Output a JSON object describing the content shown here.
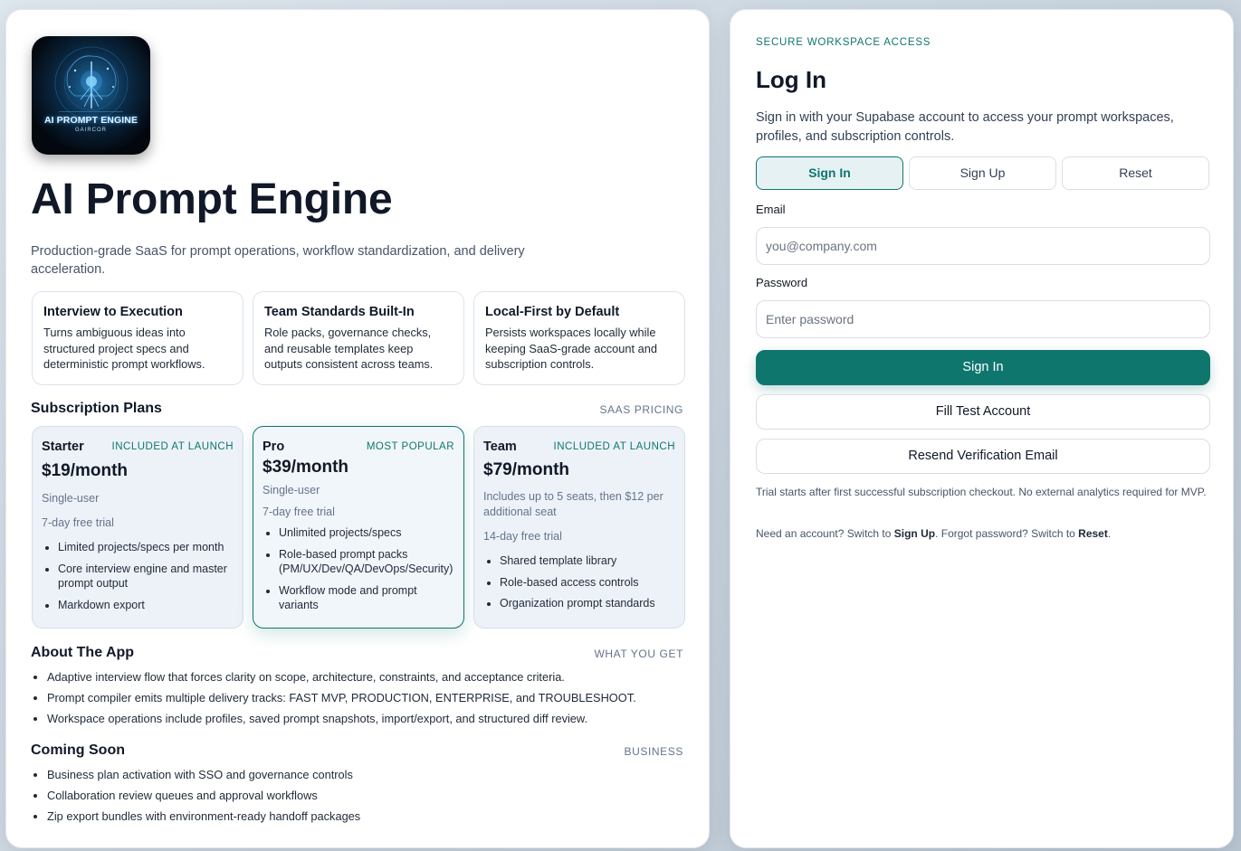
{
  "brand": {
    "logo_text": "AI PROMPT ENGINE",
    "logo_subtext": "GAIRCOR",
    "title": "AI Prompt Engine",
    "description": "Production-grade SaaS for prompt operations, workflow standardization, and delivery acceleration."
  },
  "features": [
    {
      "title": "Interview to Execution",
      "text": "Turns ambiguous ideas into structured project specs and deterministic prompt workflows."
    },
    {
      "title": "Team Standards Built-In",
      "text": "Role packs, governance checks, and reusable templates keep outputs consistent across teams."
    },
    {
      "title": "Local-First by Default",
      "text": "Persists workspaces locally while keeping SaaS-grade account and subscription controls."
    }
  ],
  "plans_section": {
    "title": "Subscription Plans",
    "tag": "SAAS PRICING"
  },
  "plans": [
    {
      "name": "Starter",
      "badge": "INCLUDED AT LAUNCH",
      "price": "$19/month",
      "meta1": "Single-user",
      "meta2": "7-day free trial",
      "features": [
        "Limited projects/specs per month",
        "Core interview engine and master prompt output",
        "Markdown export"
      ]
    },
    {
      "name": "Pro",
      "badge": "MOST POPULAR",
      "price": "$39/month",
      "meta1": "Single-user",
      "meta2": "7-day free trial",
      "features": [
        "Unlimited projects/specs",
        "Role-based prompt packs (PM/UX/Dev/QA/DevOps/Security)",
        "Workflow mode and prompt variants"
      ]
    },
    {
      "name": "Team",
      "badge": "INCLUDED AT LAUNCH",
      "price": "$79/month",
      "meta1": "Includes up to 5 seats, then $12 per additional seat",
      "meta2": "14-day free trial",
      "features": [
        "Shared template library",
        "Role-based access controls",
        "Organization prompt standards"
      ]
    }
  ],
  "about": {
    "title": "About The App",
    "tag": "WHAT YOU GET",
    "items": [
      "Adaptive interview flow that forces clarity on scope, architecture, constraints, and acceptance criteria.",
      "Prompt compiler emits multiple delivery tracks: FAST MVP, PRODUCTION, ENTERPRISE, and TROUBLESHOOT.",
      "Workspace operations include profiles, saved prompt snapshots, import/export, and structured diff review."
    ]
  },
  "coming_soon": {
    "title": "Coming Soon",
    "tag": "BUSINESS",
    "items": [
      "Business plan activation with SSO and governance controls",
      "Collaboration review queues and approval workflows",
      "Zip export bundles with environment-ready handoff packages"
    ]
  },
  "login": {
    "eyebrow": "SECURE WORKSPACE ACCESS",
    "title": "Log In",
    "description": "Sign in with your Supabase account to access your prompt workspaces, profiles, and subscription controls.",
    "tabs": [
      "Sign In",
      "Sign Up",
      "Reset"
    ],
    "email_label": "Email",
    "email_placeholder": "you@company.com",
    "password_label": "Password",
    "password_placeholder": "Enter password",
    "submit": "Sign In",
    "fill_test": "Fill Test Account",
    "resend": "Resend Verification Email",
    "trial_note": "Trial starts after first successful subscription checkout. No external analytics required for MVP.",
    "switch_prefix": "Need an account? Switch to ",
    "switch_signup": "Sign Up",
    "switch_middle": ". Forgot password? Switch to ",
    "switch_reset": "Reset",
    "switch_suffix": "."
  },
  "colors": {
    "accent": "#0f766e",
    "accent_light": "#e6f1f4",
    "plan_bg": "#edf2f8"
  }
}
